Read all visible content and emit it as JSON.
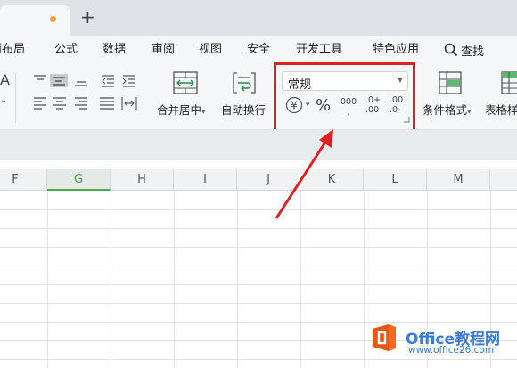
{
  "tabbar": {
    "add_label": "+"
  },
  "menu": {
    "items": [
      "页面布局",
      "公式",
      "数据",
      "审阅",
      "视图",
      "安全",
      "开发工具",
      "特色应用"
    ],
    "search_label": "查找"
  },
  "ribbon": {
    "merge_label": "合并居中",
    "wrap_label": "自动换行",
    "number_format_value": "常规",
    "currency_symbol": "¥",
    "percent_symbol": "%",
    "thousands_symbol": "000",
    "increase_decimal": [
      ".0+",
      ".00"
    ],
    "decrease_decimal": [
      ".00",
      ".0-"
    ],
    "conditional_format_label": "条件格式",
    "table_style_label": "表格样式",
    "dropdown_caret": "▾"
  },
  "grid": {
    "columns": [
      "F",
      "G",
      "H",
      "I",
      "J",
      "K",
      "L",
      "M"
    ],
    "active_column": "G"
  },
  "watermark": {
    "title": "Office教程网",
    "url": "www.office26.com",
    "colors": {
      "orange": "#f26b1d",
      "blue": "#3a7bd5"
    }
  },
  "annotation": {
    "color": "#e02020"
  }
}
